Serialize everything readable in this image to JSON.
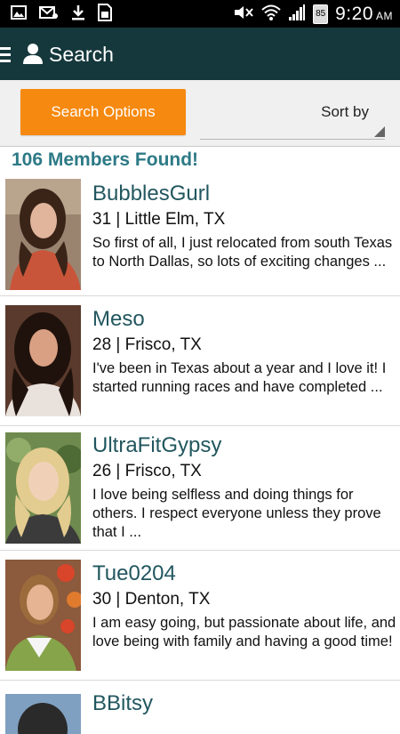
{
  "status_bar": {
    "time": "9:20",
    "ampm": "AM",
    "battery": "85",
    "left_icons": [
      "image-icon",
      "mail-icon",
      "download-icon",
      "sim-card-icon"
    ],
    "right_icons": [
      "mute-icon",
      "wifi-icon",
      "signal-icon",
      "battery-icon"
    ]
  },
  "action_bar": {
    "title": "Search"
  },
  "toolbar": {
    "search_options_label": "Search Options",
    "sort_by_label": "Sort by"
  },
  "results": {
    "count_text": "106 Members Found!"
  },
  "members": [
    {
      "name": "BubblesGurl",
      "meta": "31 | Little Elm, TX",
      "description": "So first of all, I just relocated from south Texas to North Dallas, so lots of exciting changes ..."
    },
    {
      "name": "Meso",
      "meta": "28 | Frisco, TX",
      "description": "I've been in Texas about a year and I love it! I started running races and have completed ..."
    },
    {
      "name": "UltraFitGypsy",
      "meta": "26 | Frisco, TX",
      "description": "I love being selfless and doing things for others. I respect everyone unless they prove that I ..."
    },
    {
      "name": "Tue0204",
      "meta": "30 | Denton, TX",
      "description": "I am easy going, but passionate about life, and love being with family and having a good time!"
    },
    {
      "name": "BBitsy",
      "meta": "",
      "description": ""
    }
  ],
  "colors": {
    "action_bar": "#15383c",
    "accent_orange": "#f6890f",
    "member_name": "#22575f",
    "results_count": "#2d7a86"
  }
}
